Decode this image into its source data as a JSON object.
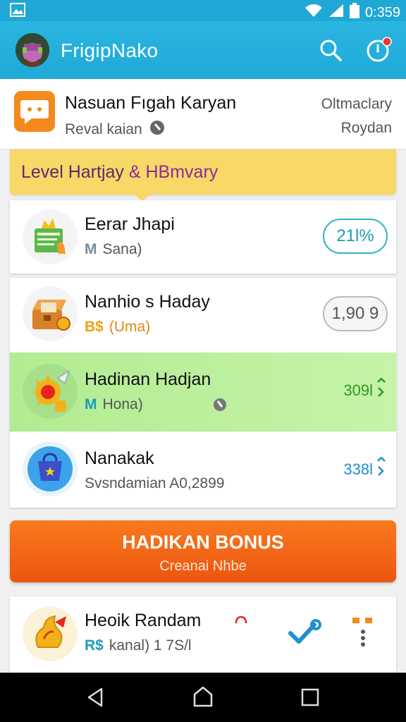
{
  "status_bar": {
    "time": "0:359"
  },
  "app_bar": {
    "title": "FrigipNako"
  },
  "profile": {
    "name": "Nasuan Fıgah Karyan",
    "subtitle": "Reval kaian",
    "right_top": "Oltmaclary",
    "right_bottom": "Roydan"
  },
  "level_banner": {
    "prefix": "Level Hartjay",
    "separator": "&",
    "highlight": "HBmvary"
  },
  "items": [
    {
      "title": "Eerar Jhapi",
      "badge": "M",
      "subtitle": "Sana)",
      "value": "21l%"
    },
    {
      "title": "Nanhio s Haday",
      "badge": "B$",
      "subtitle": "(Uma)",
      "value": "1,90 9"
    },
    {
      "title": "Hadinan Hadjan",
      "badge": "M",
      "subtitle": "Hona)",
      "value": "309l"
    },
    {
      "title": "Nanakak",
      "subtitle": "Svsndamian A0,2899",
      "value": "338l"
    },
    {
      "title": "Heoik Randam",
      "badge": "R$",
      "subtitle": "kanal) 1 7S/l"
    }
  ],
  "bonus": {
    "title": "HADIKAN BONUS",
    "subtitle": "Creanai Nhbe"
  },
  "colors": {
    "primary": "#22ABDA",
    "accent": "#F0611A",
    "highlight_row": "#B9EE9A",
    "banner": "#F8D866"
  }
}
